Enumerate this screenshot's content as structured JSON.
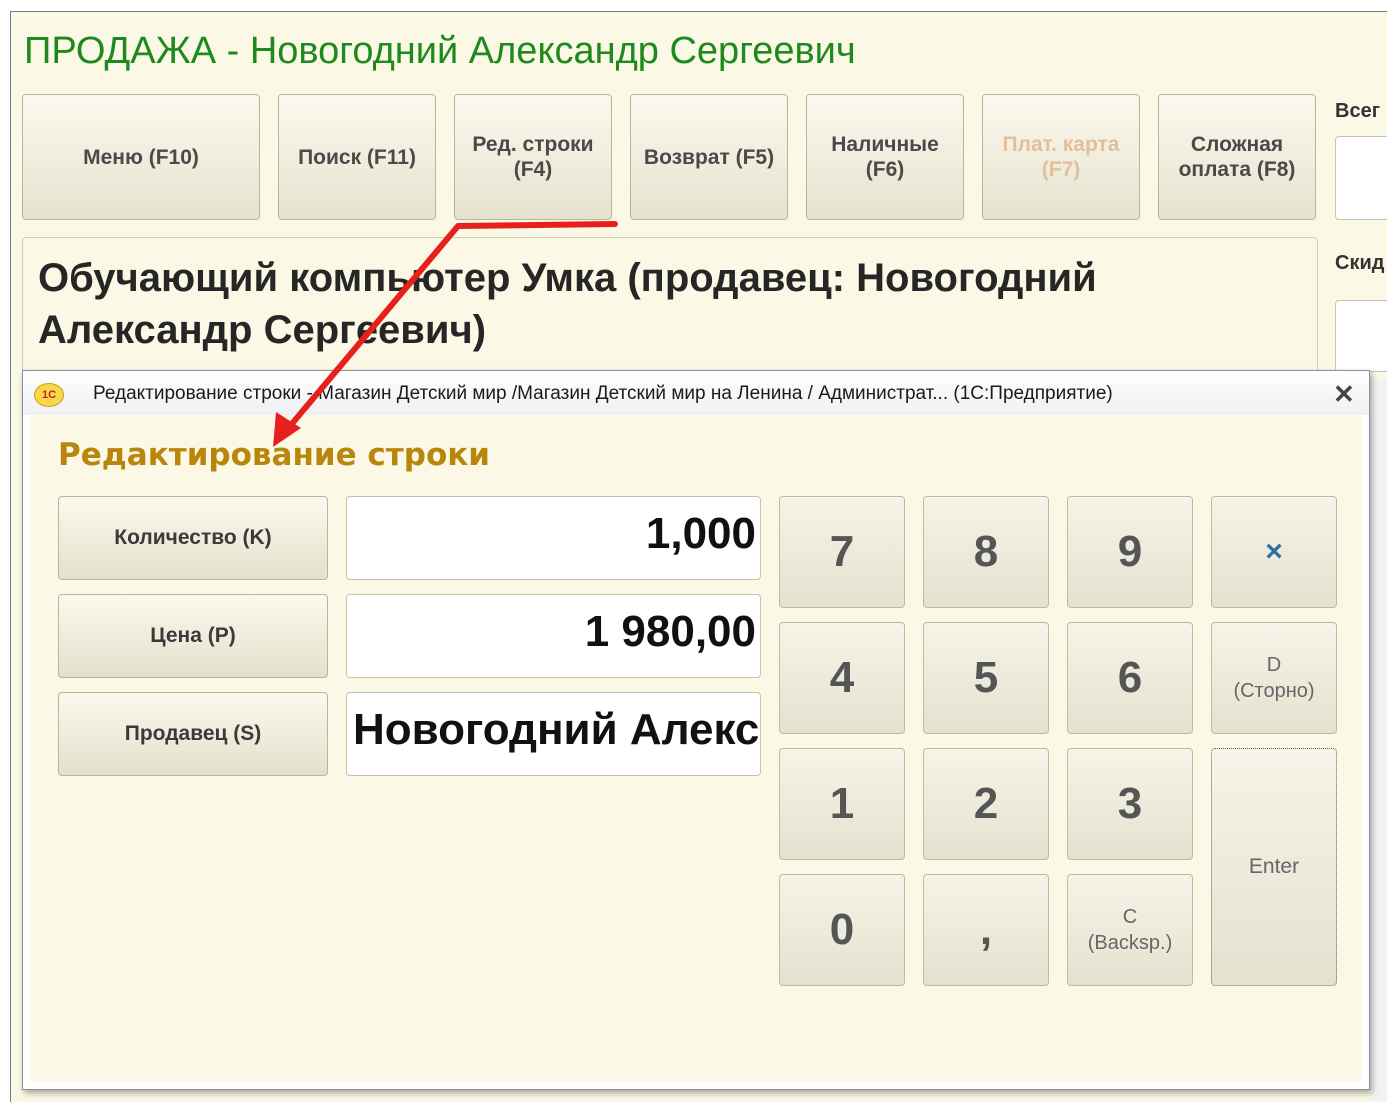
{
  "header": {
    "title": "ПРОДАЖА - Новогодний Александр Сергеевич"
  },
  "toolbar": [
    {
      "name": "menu-button",
      "label": "Меню (F10)",
      "disabled": false
    },
    {
      "name": "search-button",
      "label": "Поиск (F11)",
      "disabled": false
    },
    {
      "name": "edit-row-button",
      "label": "Ред. строки\n(F4)",
      "disabled": false
    },
    {
      "name": "return-button",
      "label": "Возврат (F5)",
      "disabled": false
    },
    {
      "name": "cash-button",
      "label": "Наличные\n(F6)",
      "disabled": false
    },
    {
      "name": "card-payment-button",
      "label": "Плат. карта\n(F7)",
      "disabled": true
    },
    {
      "name": "complex-payment-button",
      "label": "Сложная\nоплата (F8)",
      "disabled": false
    }
  ],
  "side": {
    "total_label": "Всег",
    "discount_label": "Скид"
  },
  "product": {
    "name": "Обучающий компьютер Умка (продавец: Новогодний Александр Сергеевич)"
  },
  "dialog": {
    "window_title": "Редактирование строки - Магазин Детский мир /Магазин Детский мир на Ленина / Администрат...  (1С:Предприятие)",
    "logo_text": "1С",
    "close_glyph": "✕",
    "heading": "Редактирование строки",
    "fields": [
      {
        "name": "quantity",
        "button_label": "Количество (K)",
        "value": "1,000"
      },
      {
        "name": "price",
        "button_label": "Цена (P)",
        "value": "1 980,00"
      },
      {
        "name": "seller",
        "button_label": "Продавец (S)",
        "value": "Новогодний Александр Сергеевич"
      }
    ],
    "keypad": {
      "k7": "7",
      "k8": "8",
      "k9": "9",
      "multiply": "×",
      "k4": "4",
      "k5": "5",
      "k6": "6",
      "storno": "D\n(Сторно)",
      "k1": "1",
      "k2": "2",
      "k3": "3",
      "enter": "Enter",
      "k0": "0",
      "comma": ",",
      "backspace": "C\n(Backsp.)"
    }
  },
  "annotation": {
    "arrow_color": "#e8201c"
  }
}
